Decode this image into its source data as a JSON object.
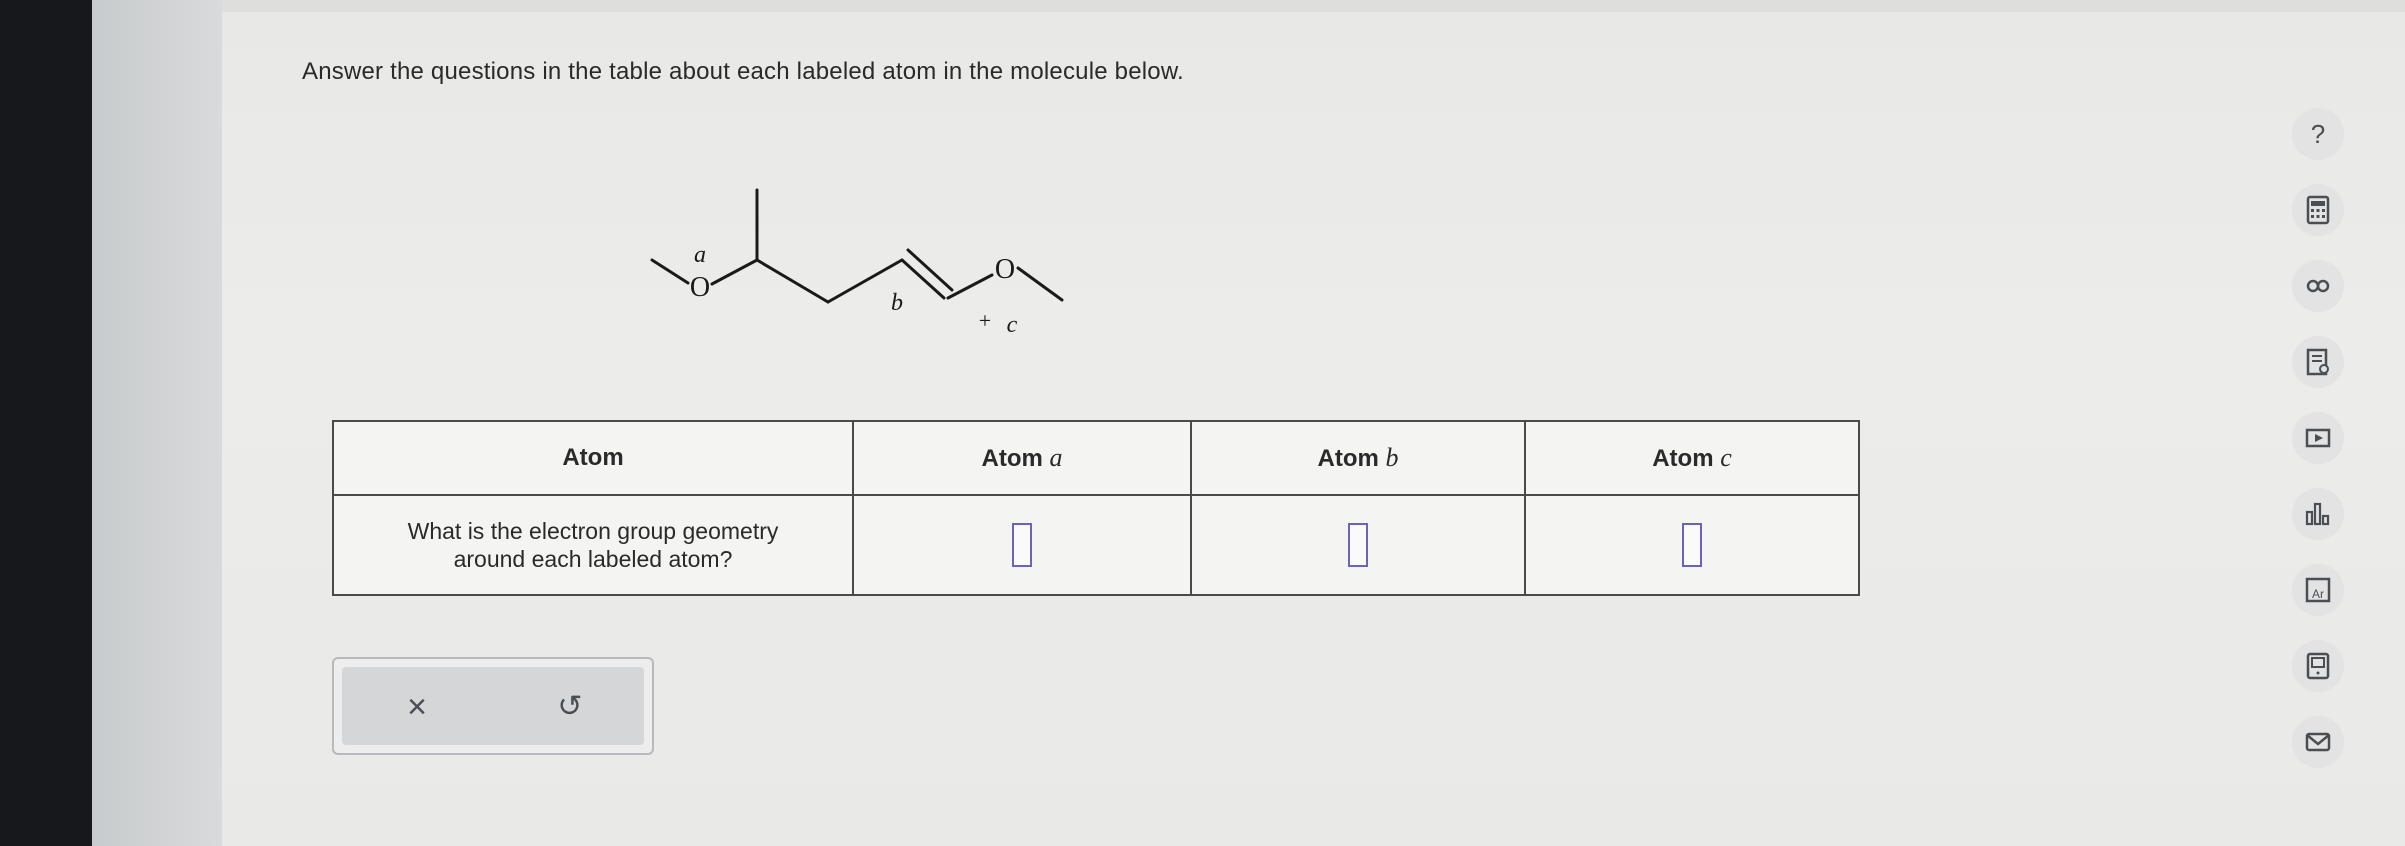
{
  "question": "Answer the questions in the table about each labeled atom in the molecule below.",
  "molecule": {
    "labels": {
      "a": "a",
      "b": "b",
      "c": "c",
      "charge": "+",
      "oxygen1": "O",
      "oxygen2": "O"
    }
  },
  "table": {
    "headers": [
      "Atom",
      "Atom",
      "Atom",
      "Atom"
    ],
    "header_italic": [
      "",
      "a",
      "b",
      "c"
    ],
    "rows": [
      {
        "question_line1": "What is the electron group geometry",
        "question_line2": "around each labeled atom?"
      }
    ]
  },
  "actions": {
    "clear_symbol": "×",
    "undo_symbol": "↺"
  },
  "sidebar": {
    "icons": [
      "help-icon",
      "calculator-icon",
      "link-icon",
      "reference-icon",
      "video-icon",
      "chart-icon",
      "periodic-table-icon",
      "ebook-icon",
      "mail-icon"
    ],
    "help_symbol": "?"
  }
}
